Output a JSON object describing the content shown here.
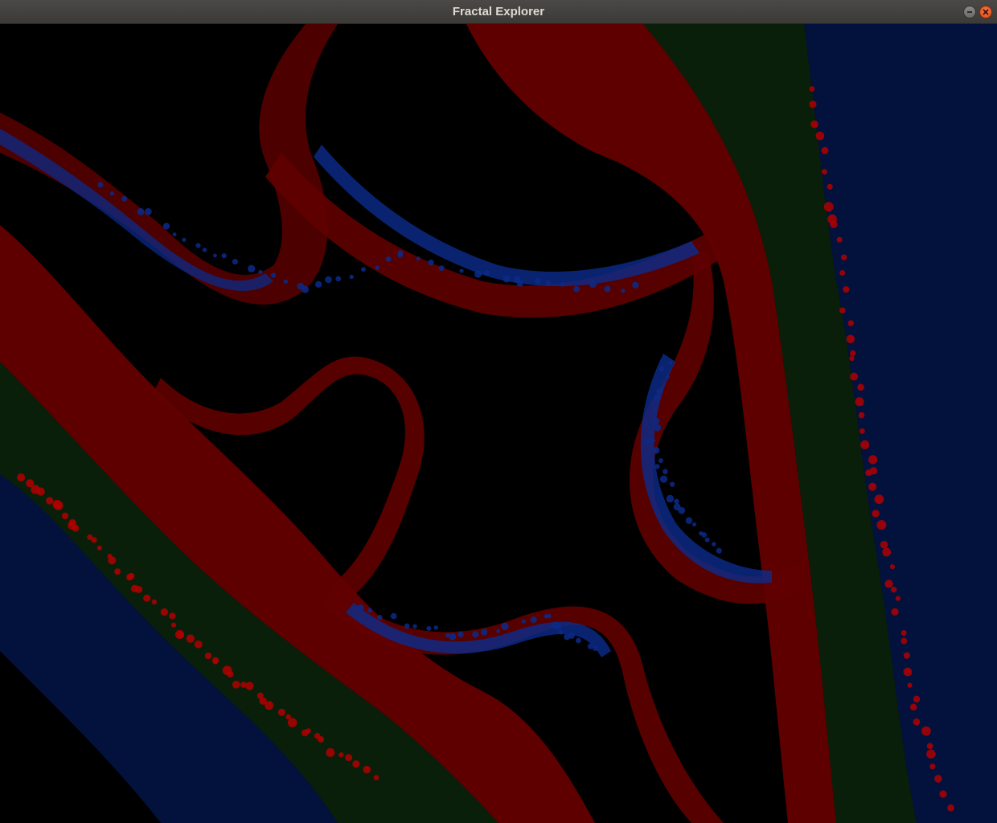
{
  "window": {
    "title": "Fractal Explorer"
  },
  "fractal": {
    "colors": {
      "black": "#000000",
      "dark_red": "#5a0000",
      "red": "#8a0000",
      "bright_red": "#b00000",
      "dark_green": "#071907",
      "green": "#0d2a0d",
      "dark_blue": "#020c2a",
      "blue": "#0a2a88",
      "navy": "#051a55"
    }
  }
}
